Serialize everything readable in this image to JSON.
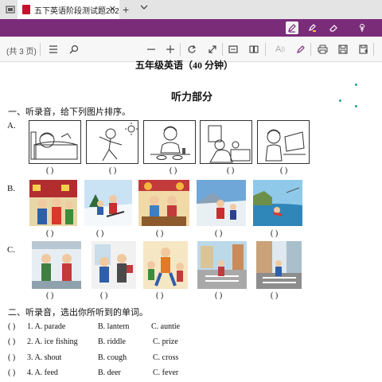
{
  "tab": {
    "title": "五下英语阶段测试题202"
  },
  "pdf_toolbar": {
    "pager": "(共 3 页)"
  },
  "document": {
    "exam_title": "五年级英语（40 分钟）",
    "listening_title": "听力部分",
    "section1": {
      "title": "一、听录音，给下列图片排序。",
      "rows": [
        {
          "label": "A.",
          "blanks": [
            "(   )",
            "(   )",
            "(   )",
            "(   )",
            "(   )"
          ]
        },
        {
          "label": "B.",
          "blanks": [
            "(   )",
            "(   )",
            "(   )",
            "(   )",
            "(   )"
          ]
        },
        {
          "label": "C.",
          "blanks": [
            "(   )",
            "(   )",
            "(   )",
            "(   )",
            "(   )"
          ]
        }
      ]
    },
    "section2": {
      "title": "二、听录音，选出你所听到的单词。",
      "questions": [
        {
          "paren": "(      )",
          "num": "1. A. parade",
          "b": "B. lantern",
          "c": "C. auntie"
        },
        {
          "paren": "(      )",
          "num": "2. A. ice fishing",
          "b": "B. riddle",
          "c": "C. prize"
        },
        {
          "paren": "(      )",
          "num": "3. A. shout",
          "b": "B. cough",
          "c": "C. cross"
        },
        {
          "paren": "(      )",
          "num": "4. A. feed",
          "b": "B. deer",
          "c": "C. fever"
        }
      ]
    }
  },
  "icons": {
    "pdf_file": "pdf-file-icon",
    "window": "window-icon",
    "close": "close-icon",
    "new_tab": "plus-icon",
    "tab_list": "chevron-down-icon",
    "pen": "pen-icon",
    "highlighter": "highlighter-icon",
    "eraser": "eraser-icon",
    "touch": "touch-icon",
    "contents": "list-icon",
    "search": "search-icon",
    "zoom_out": "minus-icon",
    "zoom_in": "plus-icon",
    "rotate": "rotate-icon",
    "fullscreen": "expand-icon",
    "fit": "fit-page-icon",
    "two_page": "two-page-icon",
    "read_aloud": "read-aloud-icon",
    "draw": "draw-icon",
    "print": "print-icon",
    "save": "save-icon",
    "save_as": "save-as-icon"
  },
  "colors": {
    "accent": "#7b2c79",
    "teal_dot": "#2a9d8f"
  }
}
